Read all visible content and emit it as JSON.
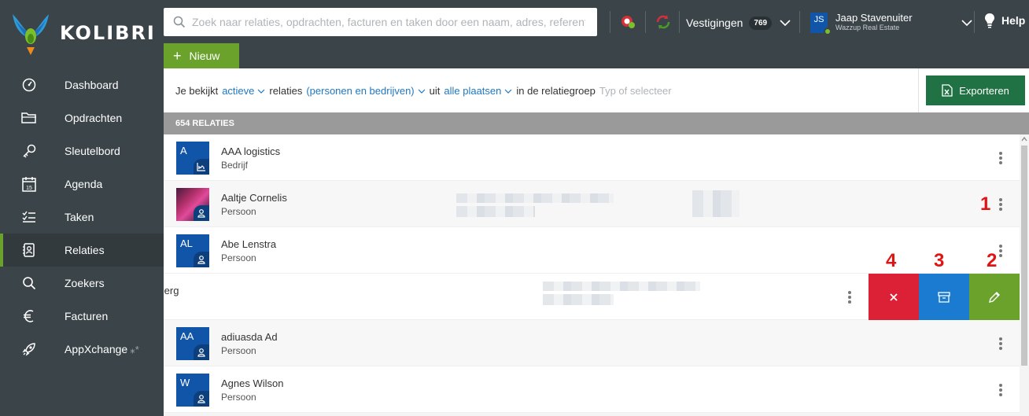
{
  "app": {
    "name": "KOLIBRI"
  },
  "search": {
    "placeholder": "Zoek naar relaties, opdrachten, facturen en taken door een naam, adres, referentie of ..."
  },
  "topbar": {
    "vestigingen_label": "Vestigingen",
    "vestigingen_count": "769",
    "user_initials": "JS",
    "user_name": "Jaap Stavenuiter",
    "user_org": "Wazzup Real Estate",
    "help_label": "Help"
  },
  "new_button": {
    "label": "Nieuw"
  },
  "sidebar": {
    "items": [
      {
        "label": "Dashboard",
        "icon": "dashboard-icon"
      },
      {
        "label": "Opdrachten",
        "icon": "folder-icon"
      },
      {
        "label": "Sleutelbord",
        "icon": "key-icon"
      },
      {
        "label": "Agenda",
        "icon": "calendar-icon"
      },
      {
        "label": "Taken",
        "icon": "tasks-icon"
      },
      {
        "label": "Relaties",
        "icon": "contacts-icon",
        "active": true
      },
      {
        "label": "Zoekers",
        "icon": "search-icon"
      },
      {
        "label": "Facturen",
        "icon": "euro-icon"
      },
      {
        "label": "AppXchange",
        "icon": "rocket-icon"
      }
    ]
  },
  "filter": {
    "t1": "Je bekijkt",
    "status": "actieve",
    "t2": "relaties",
    "type": "(personen en bedrijven)",
    "t3": "uit",
    "place": "alle plaatsen",
    "t4": "in de relatiegroep",
    "group_placeholder": "Typ of selecteer"
  },
  "export_button": {
    "label": "Exporteren"
  },
  "count_label": "654 RELATIES",
  "rows": [
    {
      "initials": "A",
      "name": "AAA logistics",
      "type": "Bedrijf"
    },
    {
      "initials": "",
      "name": "Aaltje Cornelis",
      "type": "Persoon"
    },
    {
      "initials": "AL",
      "name": "Abe Lenstra",
      "type": "Persoon"
    },
    {
      "initials": "",
      "name": "Berg",
      "type": ""
    },
    {
      "initials": "AA",
      "name": "adiuasda Ad",
      "type": "Persoon"
    },
    {
      "initials": "W",
      "name": "Agnes Wilson",
      "type": "Persoon"
    }
  ],
  "swipe_actions": {
    "delete": "close-icon",
    "archive": "archive-icon",
    "edit": "pencil-icon"
  },
  "annotations": {
    "n1": "1",
    "n2": "2",
    "n3": "3",
    "n4": "4"
  },
  "colors": {
    "sidebar": "#3b4449",
    "accent_green": "#6aa22c",
    "blue": "#1155a8",
    "delete": "#dc2136",
    "archive": "#1a7bd0",
    "excel": "#207245",
    "marker_red": "#e01414"
  }
}
